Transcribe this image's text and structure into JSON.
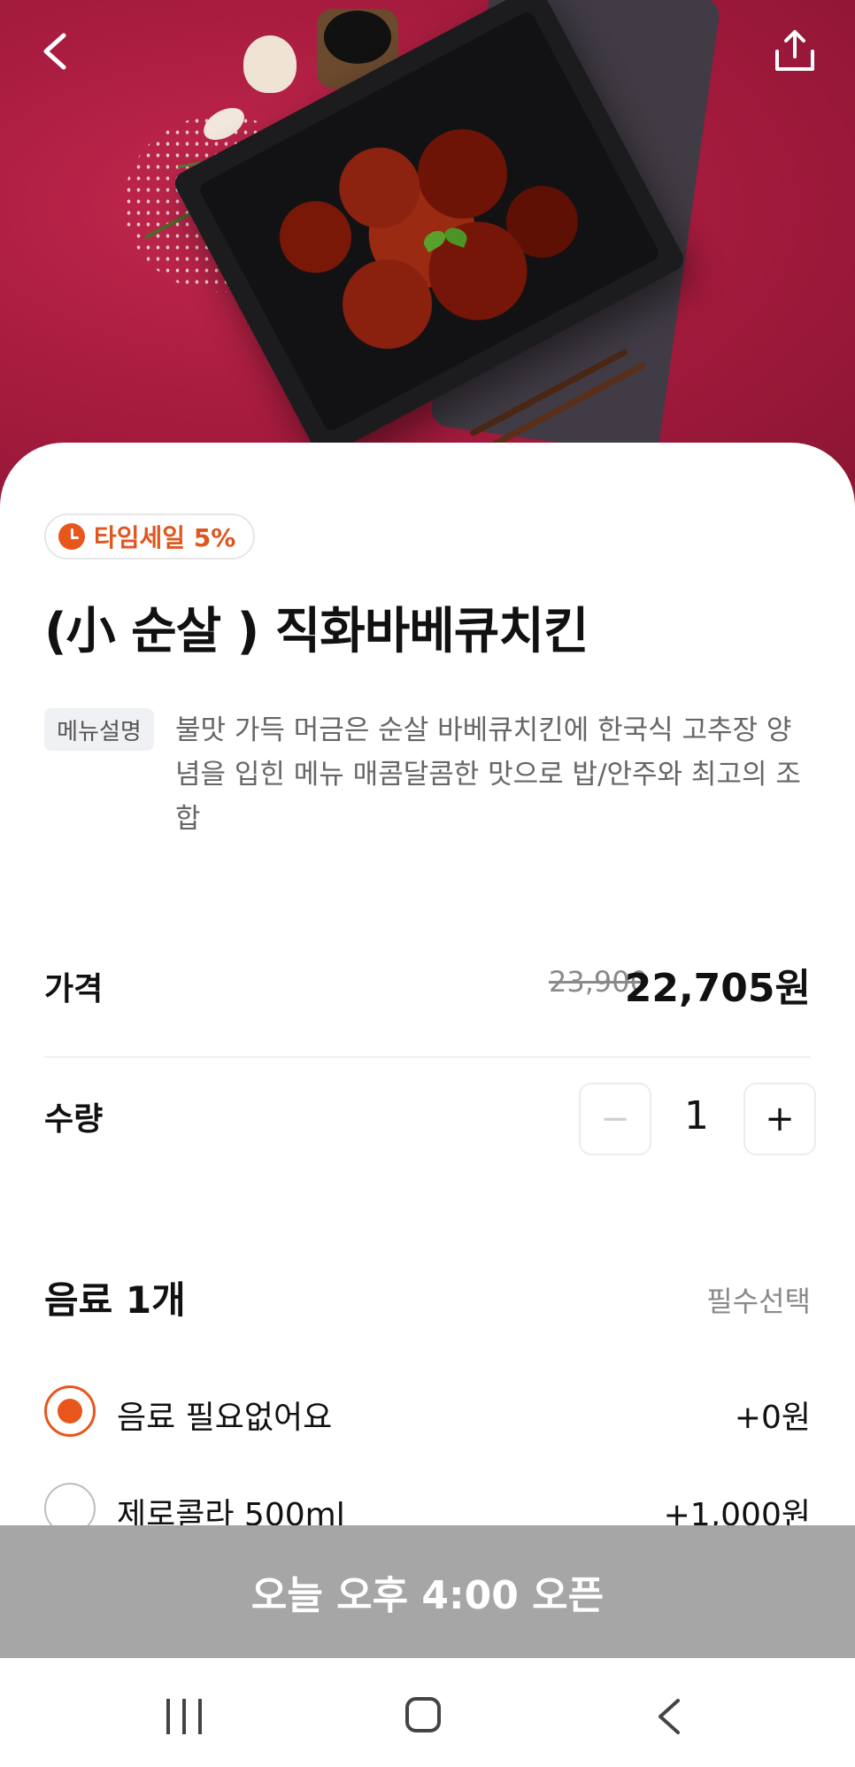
{
  "badge": {
    "label": "타임세일 5%"
  },
  "product": {
    "title": "(小 순살 ) 직화바베큐치킨",
    "desc_tag": "메뉴설명",
    "description": "불맛 가득 머금은 순살 바베큐치킨에 한국식 고추장 양념을 입힌 메뉴 매콤달콤한 맛으로 밥/안주와 최고의 조합"
  },
  "price": {
    "label": "가격",
    "original": "23,900",
    "sale": "22,705원"
  },
  "quantity": {
    "label": "수량",
    "minus": "−",
    "value": "1",
    "plus": "+"
  },
  "options": {
    "title": "음료 1개",
    "required": "필수선택",
    "items": [
      {
        "label": "음료 필요없어요",
        "price": "+0원",
        "selected": true
      },
      {
        "label": "제로콜라 500ml",
        "price": "+1,000원",
        "selected": false
      }
    ]
  },
  "cta": {
    "label": "오늘 오후 4:00 오픈"
  },
  "colors": {
    "accent": "#e8561c",
    "disabled_bar": "#a6a6a6",
    "hero_bg": "#a81c3f"
  },
  "icons": {
    "back": "back-arrow-icon",
    "share": "share-icon",
    "badge": "clock-icon"
  }
}
